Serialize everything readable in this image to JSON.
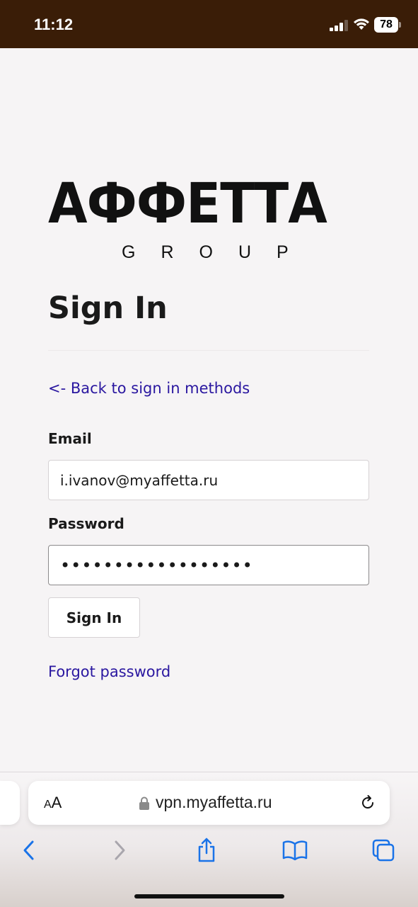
{
  "status_bar": {
    "time": "11:12",
    "battery": "78",
    "icons": [
      "signal-icon",
      "wifi-icon",
      "battery-icon"
    ]
  },
  "logo": {
    "main": "АФФЕТТА",
    "sub": "GROUP"
  },
  "page": {
    "title": "Sign In",
    "back_link": "<- Back to sign in methods",
    "email_label": "Email",
    "email_value": "i.ivanov@myaffetta.ru",
    "password_label": "Password",
    "password_value": "••••••••••••••••••",
    "submit_label": "Sign In",
    "forgot_link": "Forgot password"
  },
  "browser": {
    "aa_small": "A",
    "aa_big": "A",
    "url": "vpn.myaffetta.ru",
    "toolbar_icons": [
      "back-icon",
      "forward-icon",
      "share-icon",
      "bookmarks-icon",
      "tabs-icon"
    ]
  },
  "colors": {
    "status_bar_bg": "#3a1d07",
    "page_bg": "#f6f4f5",
    "link": "#2a17a0",
    "ios_blue": "#1a73e8"
  }
}
